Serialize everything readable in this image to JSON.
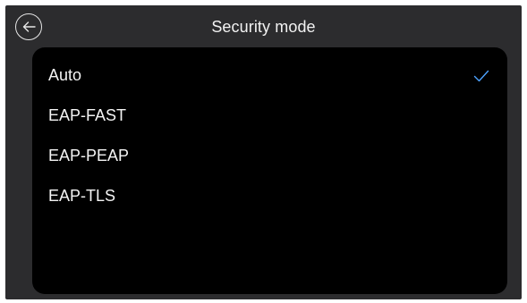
{
  "header": {
    "title": "Security mode",
    "back_icon": "arrow-left-icon"
  },
  "options": [
    {
      "label": "Auto",
      "selected": true
    },
    {
      "label": "EAP-FAST",
      "selected": false
    },
    {
      "label": "EAP-PEAP",
      "selected": false
    },
    {
      "label": "EAP-TLS",
      "selected": false
    }
  ],
  "colors": {
    "background": "#2c2c2e",
    "panel": "#000000",
    "text": "#f4f4f4",
    "accent": "#4da3ff"
  },
  "icons": {
    "selected": "checkmark-icon"
  }
}
